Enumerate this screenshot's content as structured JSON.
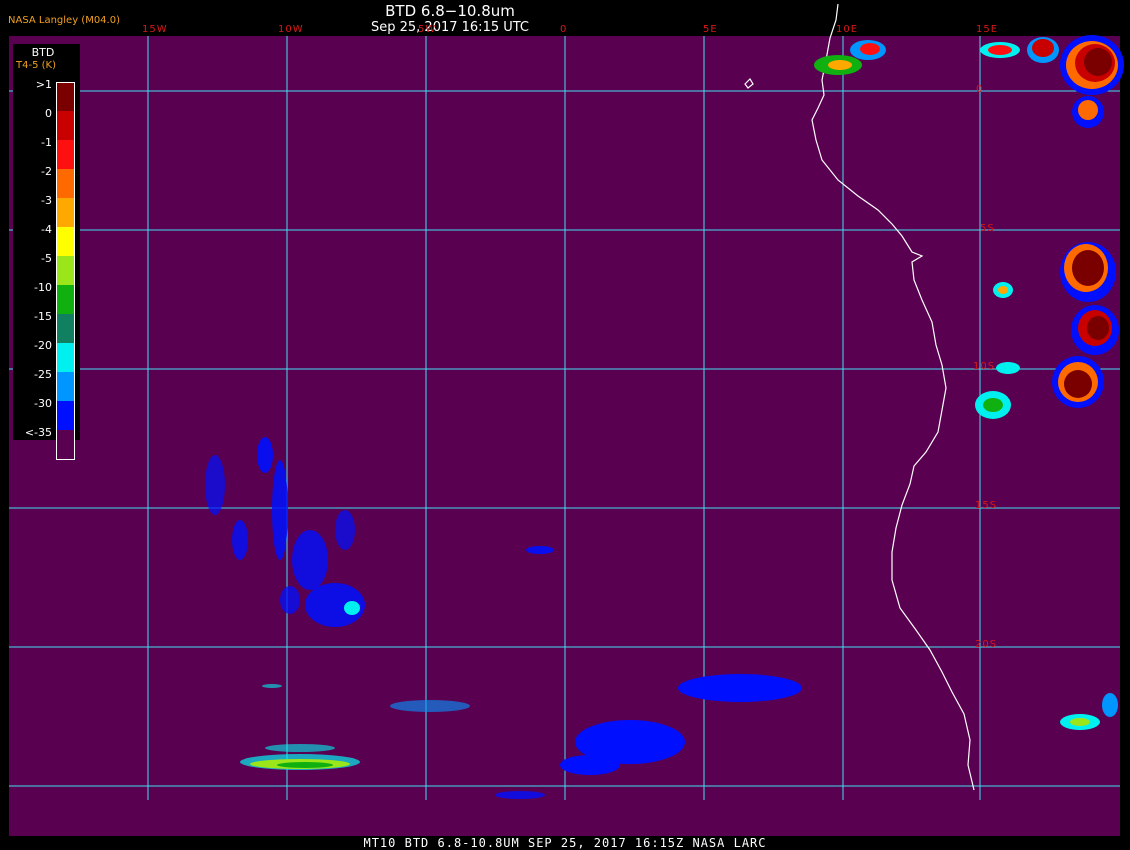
{
  "header": {
    "credit": "NASA Langley (M04.0)",
    "title": "BTD 6.8−10.8um",
    "timestamp": "Sep 25, 2017 16:15 UTC"
  },
  "footer": {
    "caption": "MT10  BTD 6.8-10.8UM   SEP 25, 2017 16:15Z   NASA LARC"
  },
  "legend": {
    "title": "BTD",
    "subtitle": "T4-5 (K)",
    "labels": [
      ">1",
      "0",
      "-1",
      "-2",
      "-3",
      "-4",
      "-5",
      "-10",
      "-15",
      "-20",
      "-25",
      "-30",
      "<-35"
    ],
    "colors": [
      "#7a0000",
      "#c80000",
      "#ff1010",
      "#ff6a00",
      "#ffa800",
      "#ffff00",
      "#9ae61a",
      "#10b010",
      "#108060",
      "#00f0f0",
      "#0096ff",
      "#0010ff",
      "#5a0050"
    ]
  },
  "grid": {
    "longitude_labels": [
      "15W",
      "10W",
      "5W",
      "0",
      "5E",
      "10E",
      "15E"
    ],
    "latitude_labels": [
      "0",
      "5S",
      "10S",
      "15S",
      "20S"
    ]
  },
  "colors": {
    "background": "#5a0050",
    "gridlines": "#40e0f0",
    "coastline": "#ffffff",
    "labels": "#d81818"
  }
}
